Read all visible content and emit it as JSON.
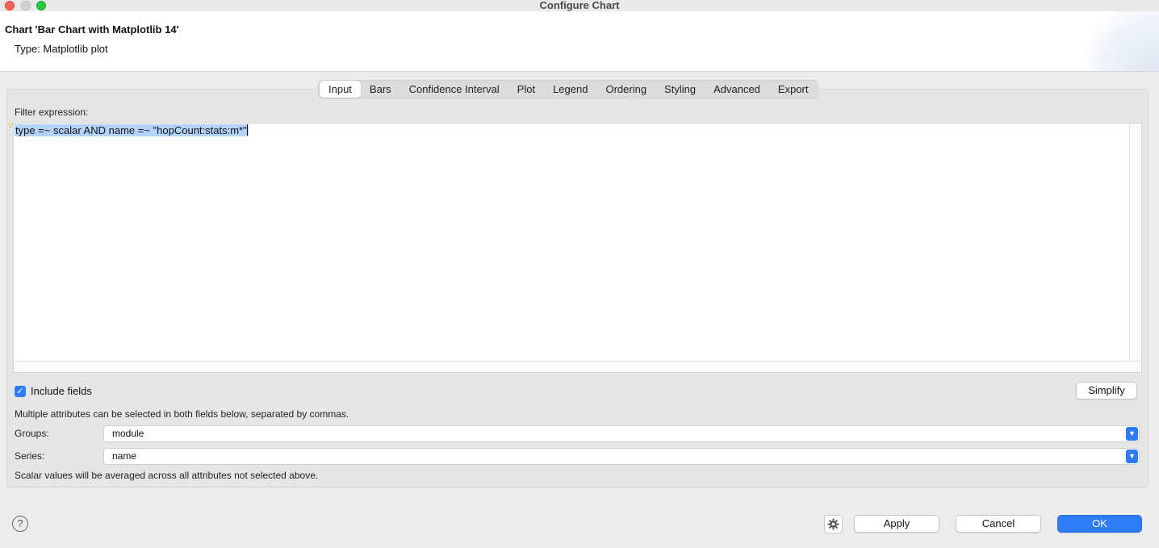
{
  "window": {
    "title": "Configure Chart"
  },
  "header": {
    "chart_title": "Chart 'Bar Chart with Matplotlib 14'",
    "chart_type": "Type: Matplotlib plot"
  },
  "tabs": [
    {
      "label": "Input",
      "active": true
    },
    {
      "label": "Bars"
    },
    {
      "label": "Confidence Interval"
    },
    {
      "label": "Plot"
    },
    {
      "label": "Legend"
    },
    {
      "label": "Ordering"
    },
    {
      "label": "Styling"
    },
    {
      "label": "Advanced"
    },
    {
      "label": "Export"
    }
  ],
  "input": {
    "filter_label": "Filter expression:",
    "filter_value": "type =~ scalar AND name =~ \"hopCount:stats:m*\"",
    "include_fields_label": "Include fields",
    "include_fields_checked": true,
    "simplify_label": "Simplify",
    "multi_attr_note": "Multiple attributes can be selected in both fields below, separated by commas.",
    "groups_label": "Groups:",
    "groups_value": "module",
    "series_label": "Series:",
    "series_value": "name",
    "scalar_note": "Scalar values will be averaged across all attributes not selected above."
  },
  "footer": {
    "help_icon": "question-mark-icon",
    "settings_icon": "gear-icon",
    "apply_label": "Apply",
    "cancel_label": "Cancel",
    "ok_label": "OK"
  },
  "colors": {
    "accent": "#2d7cf6",
    "selection": "#b4d3fa",
    "close": "#fe5f57",
    "maximize": "#28c840"
  }
}
